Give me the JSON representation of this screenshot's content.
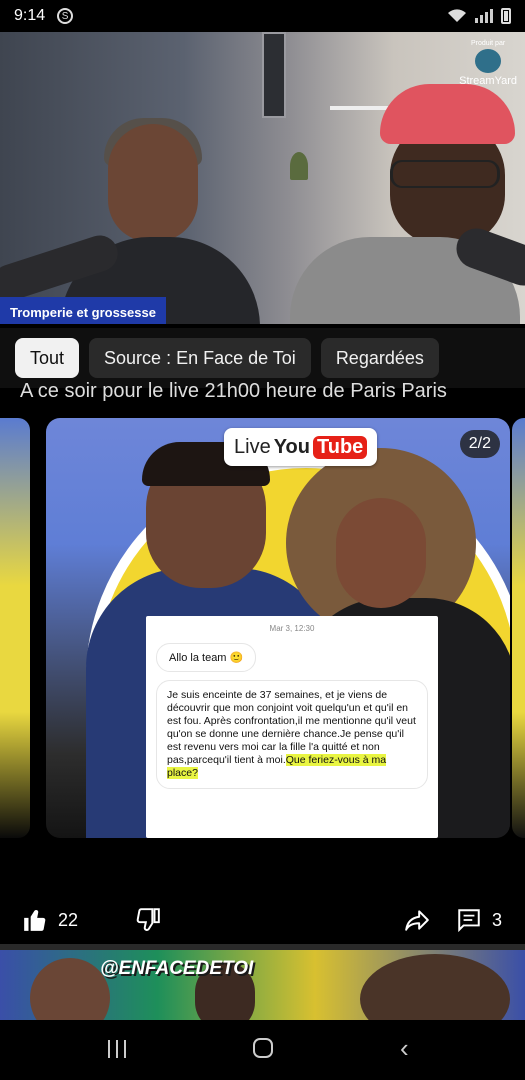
{
  "status_bar": {
    "time": "9:14",
    "s_badge": "S"
  },
  "video": {
    "lower_third": "Tromperie et grossesse",
    "overlay_logo_caption": "Produit par",
    "overlay_logo_name": "StreamYard"
  },
  "chips": [
    {
      "label": "Tout",
      "active": true
    },
    {
      "label": "Source : En Face de Toi",
      "active": false
    },
    {
      "label": "Regardées",
      "active": false
    }
  ],
  "post": {
    "text": "A ce soir pour le live  21h00 heure de Paris Paris",
    "carousel_counter": "2/2",
    "live_badge": {
      "live": "Live",
      "you": "You",
      "tube": "Tube"
    },
    "message": {
      "date": "Mar 3, 12:30",
      "greeting": "Allo la team 🙂",
      "body": "Je suis enceinte de 37 semaines, et je viens de découvrir que mon conjoint voit quelqu'un et qu'il en est fou. Après confrontation,il me mentionne qu'il veut qu'on se donne une dernière chance.Je pense qu'il est revenu vers moi car la fille l'a quitté et non pas,parcequ'il tient à moi.",
      "highlight": "Que feriez-vous à ma place?"
    },
    "likes": "22",
    "comments": "3"
  },
  "next_item": {
    "handle": "@ENFACEDETOI"
  },
  "colors": {
    "chip_active_bg": "#f1f1f1",
    "chip_bg": "#2a2a2a",
    "lower_third_bg": "#1f3aa8",
    "youtube_red": "#e62117",
    "highlight": "#e9f542"
  }
}
